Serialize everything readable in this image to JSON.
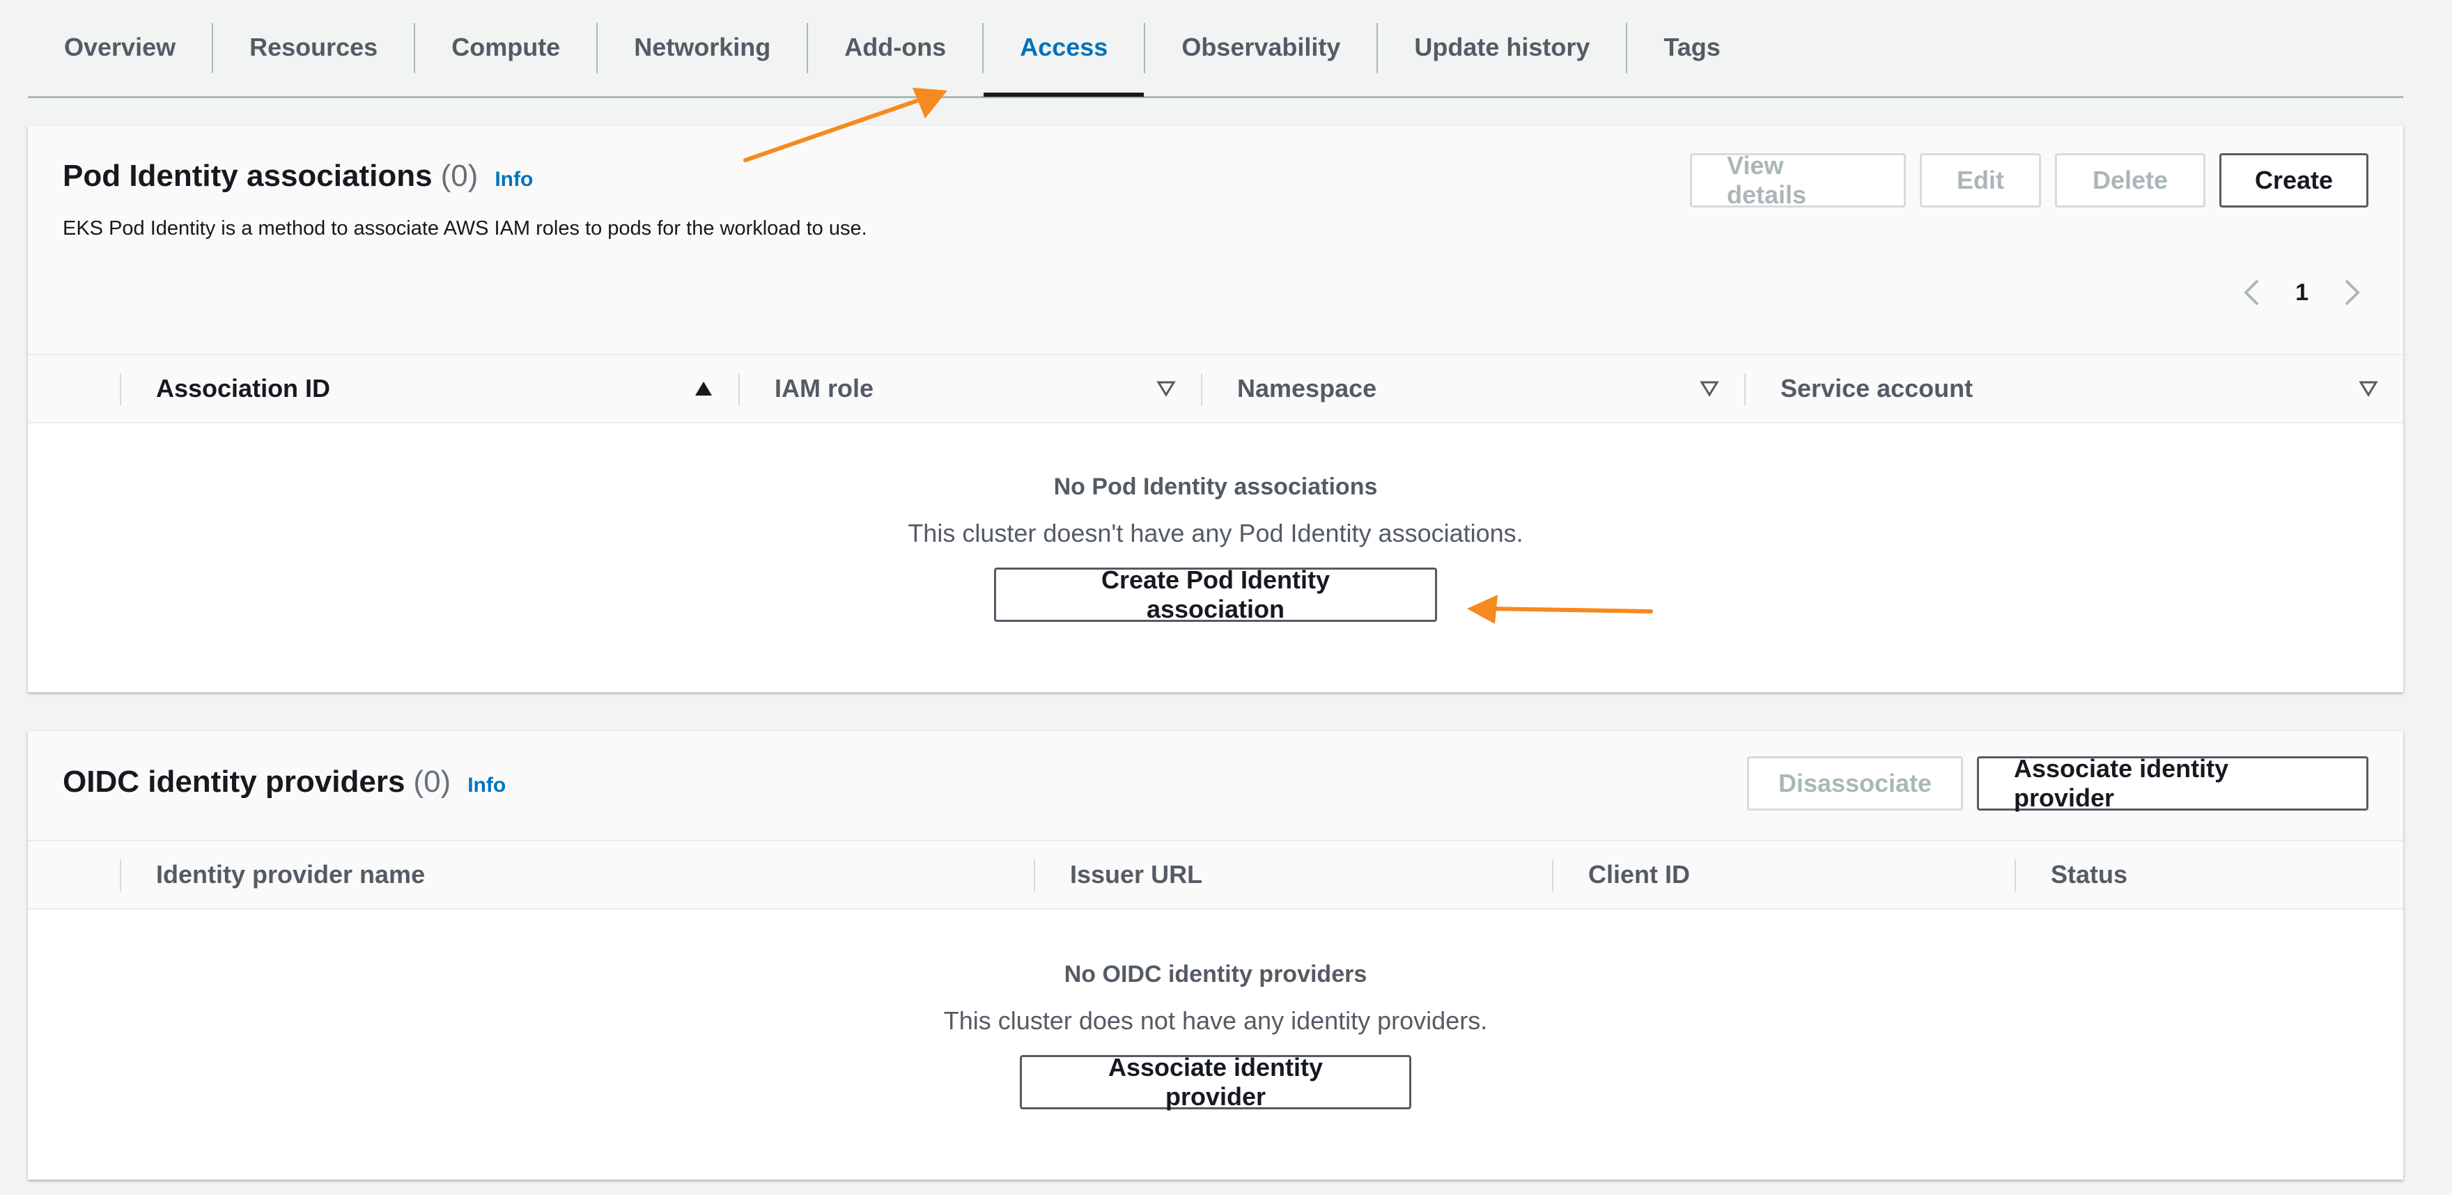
{
  "tabs": [
    {
      "label": "Overview"
    },
    {
      "label": "Resources"
    },
    {
      "label": "Compute"
    },
    {
      "label": "Networking"
    },
    {
      "label": "Add-ons"
    },
    {
      "label": "Access"
    },
    {
      "label": "Observability"
    },
    {
      "label": "Update history"
    },
    {
      "label": "Tags"
    }
  ],
  "active_tab": "Access",
  "pod_identity": {
    "title": "Pod Identity associations",
    "count": "(0)",
    "info": "Info",
    "description": "EKS Pod Identity is a method to associate AWS IAM roles to pods for the workload to use.",
    "buttons": {
      "view_details": "View details",
      "edit": "Edit",
      "delete": "Delete",
      "create": "Create"
    },
    "page": "1",
    "columns": [
      "Association ID",
      "IAM role",
      "Namespace",
      "Service account"
    ],
    "empty_title": "No Pod Identity associations",
    "empty_text": "This cluster doesn't have any Pod Identity associations.",
    "empty_button": "Create Pod Identity association"
  },
  "oidc": {
    "title": "OIDC identity providers",
    "count": "(0)",
    "info": "Info",
    "buttons": {
      "disassociate": "Disassociate",
      "associate": "Associate identity provider"
    },
    "columns": [
      "Identity provider name",
      "Issuer URL",
      "Client ID",
      "Status"
    ],
    "empty_title": "No OIDC identity providers",
    "empty_text": "This cluster does not have any identity providers.",
    "empty_button": "Associate identity provider"
  },
  "colors": {
    "accent": "#0073bb",
    "annotation_arrow": "#f58a1f"
  }
}
